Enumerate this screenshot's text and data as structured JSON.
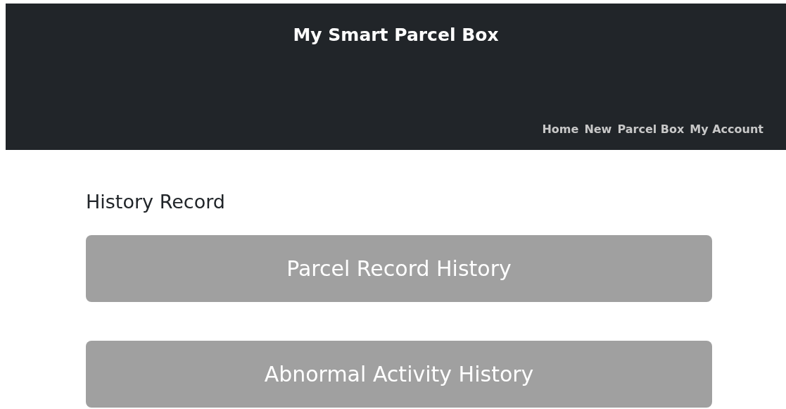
{
  "header": {
    "title": "My Smart Parcel Box",
    "nav": [
      {
        "label": "Home"
      },
      {
        "label": "New"
      },
      {
        "label": "Parcel Box"
      },
      {
        "label": "My Account"
      }
    ]
  },
  "section": {
    "heading": "History Record",
    "buttons": [
      {
        "label": "Parcel Record History"
      },
      {
        "label": "Abnormal Activity History"
      }
    ]
  }
}
